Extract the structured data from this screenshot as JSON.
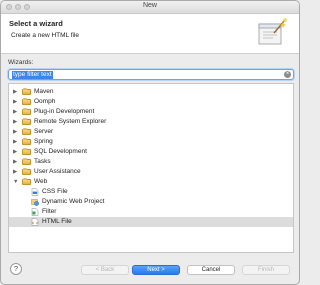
{
  "window": {
    "title": "New"
  },
  "banner": {
    "heading": "Select a wizard",
    "subheading": "Create a new HTML file"
  },
  "wizards_label": "Wizards:",
  "filter": {
    "value": "type filter text"
  },
  "tree": {
    "items": [
      {
        "label": "Maven",
        "kind": "folder",
        "expanded": false,
        "level": 0
      },
      {
        "label": "Oomph",
        "kind": "folder",
        "expanded": false,
        "level": 0
      },
      {
        "label": "Plug-in Development",
        "kind": "folder",
        "expanded": false,
        "level": 0
      },
      {
        "label": "Remote System Explorer",
        "kind": "folder",
        "expanded": false,
        "level": 0
      },
      {
        "label": "Server",
        "kind": "folder",
        "expanded": false,
        "level": 0
      },
      {
        "label": "Spring",
        "kind": "folder",
        "expanded": false,
        "level": 0
      },
      {
        "label": "SQL Development",
        "kind": "folder",
        "expanded": false,
        "level": 0
      },
      {
        "label": "Tasks",
        "kind": "folder",
        "expanded": false,
        "level": 0
      },
      {
        "label": "User Assistance",
        "kind": "folder",
        "expanded": false,
        "level": 0
      },
      {
        "label": "Web",
        "kind": "folder",
        "expanded": true,
        "level": 0
      },
      {
        "label": "CSS File",
        "kind": "file",
        "icon": "css-file-icon",
        "level": 1
      },
      {
        "label": "Dynamic Web Project",
        "kind": "file",
        "icon": "web-project-icon",
        "level": 1
      },
      {
        "label": "Filter",
        "kind": "file",
        "icon": "filter-icon",
        "level": 1
      },
      {
        "label": "HTML File",
        "kind": "file",
        "icon": "html-file-icon",
        "level": 1,
        "selected": true
      }
    ]
  },
  "buttons": {
    "help": "?",
    "back": "< Back",
    "next": "Next >",
    "cancel": "Cancel",
    "finish": "Finish"
  },
  "colors": {
    "accent": "#3d86e9",
    "selection": "#dcdcdc",
    "folder": "#e5b247"
  }
}
